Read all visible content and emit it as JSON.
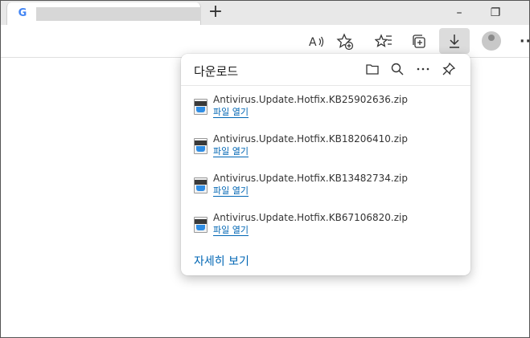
{
  "browser": {
    "tab": {
      "favicon": "G"
    },
    "new_tab_glyph": "+",
    "controls": {
      "minimize": "–",
      "restore": "❐"
    }
  },
  "toolbar": {
    "read_aloud": "A̩)",
    "more": "···"
  },
  "downloads": {
    "title": "다운로드",
    "items": [
      {
        "filename": "Antivirus.Update.Hotfix.KB25902636.zip",
        "action": "파일 열기"
      },
      {
        "filename": "Antivirus.Update.Hotfix.KB18206410.zip",
        "action": "파일 열기"
      },
      {
        "filename": "Antivirus.Update.Hotfix.KB13482734.zip",
        "action": "파일 열기"
      },
      {
        "filename": "Antivirus.Update.Hotfix.KB67106820.zip",
        "action": "파일 열기"
      }
    ],
    "see_more": "자세히 보기"
  }
}
